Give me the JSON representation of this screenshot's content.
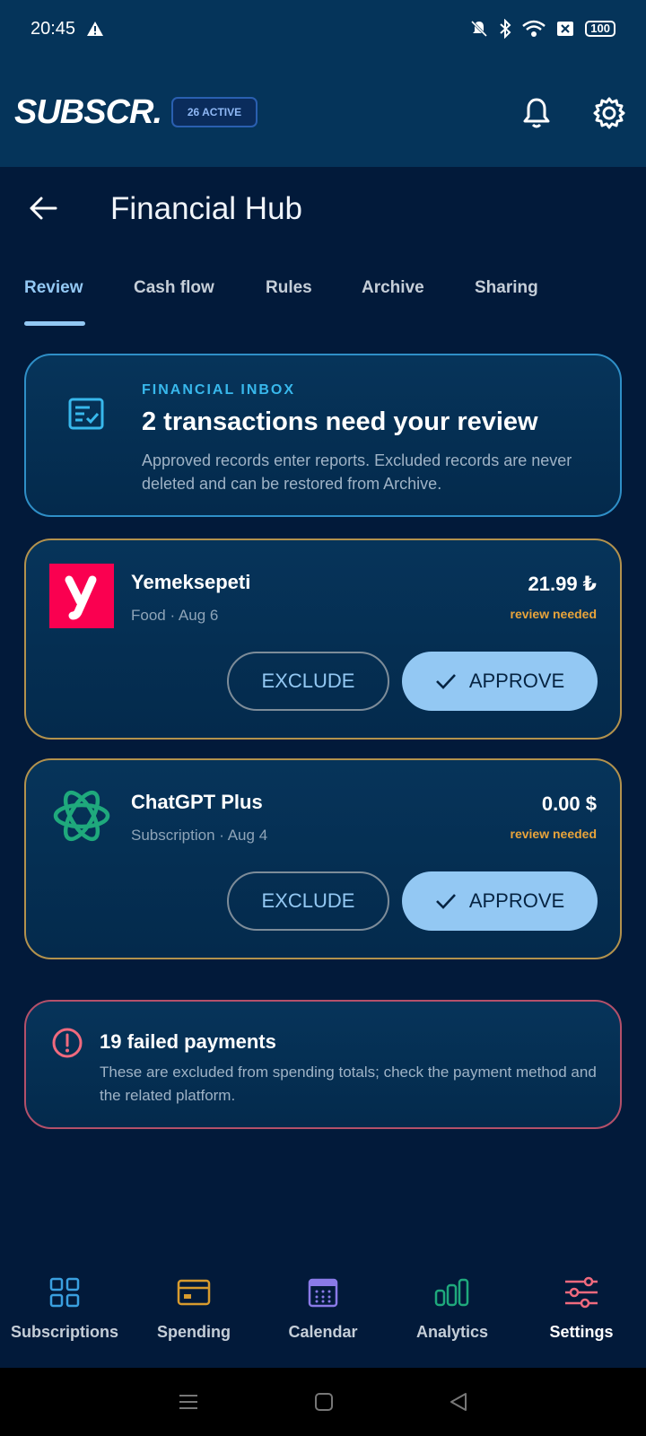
{
  "status_bar": {
    "time": "20:45",
    "battery": "100"
  },
  "header": {
    "logo": "SUBSCR.",
    "active_badge": "26 ACTIVE"
  },
  "page": {
    "title": "Financial Hub"
  },
  "tabs": [
    {
      "label": "Review",
      "active": true
    },
    {
      "label": "Cash flow",
      "active": false
    },
    {
      "label": "Rules",
      "active": false
    },
    {
      "label": "Archive",
      "active": false
    },
    {
      "label": "Sharing",
      "active": false
    }
  ],
  "inbox": {
    "kicker": "FINANCIAL INBOX",
    "title": "2 transactions need your review",
    "description": "Approved records enter reports. Excluded records are never deleted and can be restored from Archive."
  },
  "transactions": [
    {
      "name": "Yemeksepeti",
      "meta": "Food · Aug 6",
      "amount": "21.99 ₺",
      "status": "review needed",
      "exclude_label": "EXCLUDE",
      "approve_label": "APPROVE",
      "icon": "yemeksepeti-logo"
    },
    {
      "name": "ChatGPT Plus",
      "meta": "Subscription · Aug 4",
      "amount": "0.00 $",
      "status": "review needed",
      "exclude_label": "EXCLUDE",
      "approve_label": "APPROVE",
      "icon": "openai-logo"
    }
  ],
  "failed": {
    "title": "19 failed payments",
    "description": "These are excluded from spending totals; check the payment method and the related platform."
  },
  "bottom_nav": [
    {
      "label": "Subscriptions",
      "icon": "grid-icon",
      "color": "#3aa0e0"
    },
    {
      "label": "Spending",
      "icon": "card-icon",
      "color": "#d79b2e"
    },
    {
      "label": "Calendar",
      "icon": "calendar-icon",
      "color": "#8a7ae8"
    },
    {
      "label": "Analytics",
      "icon": "bar-chart-icon",
      "color": "#1fa97c"
    },
    {
      "label": "Settings",
      "icon": "sliders-icon",
      "color": "#f06a7e",
      "active": true
    }
  ],
  "colors": {
    "background": "#021a3a",
    "header": "#05345a",
    "accent": "#93c8f3",
    "warning": "#e9a43a",
    "error": "#b4506a"
  }
}
